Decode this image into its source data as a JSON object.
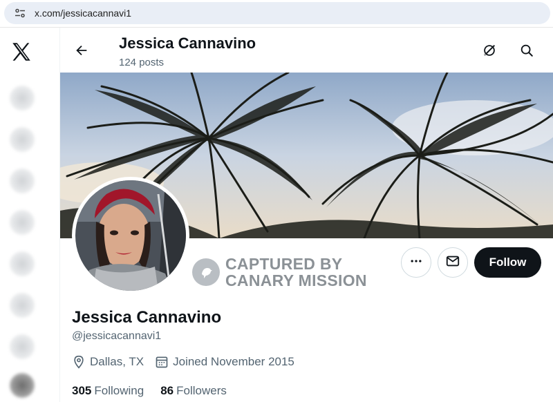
{
  "browser": {
    "url": "x.com/jessicacannavi1",
    "site_info_icon": "tune-icon"
  },
  "sidebar": {
    "logo": "x-logo-icon",
    "blurred_items": 8
  },
  "header": {
    "back_icon": "arrow-left-icon",
    "name": "Jessica Cannavino",
    "posts": "124 posts",
    "grok_icon": "grok-icon",
    "search_icon": "search-icon"
  },
  "banner": {
    "description": "palm trees silhouette against sky"
  },
  "watermark": {
    "line1": "CAPTURED BY",
    "line2": "CANARY MISSION",
    "badge_icon": "canary-bird-icon"
  },
  "actions": {
    "more_icon": "more-icon",
    "message_icon": "mail-icon",
    "follow_label": "Follow"
  },
  "profile": {
    "name": "Jessica Cannavino",
    "handle": "@jessicacannavi1",
    "location": "Dallas, TX",
    "joined": "Joined November 2015",
    "following_count": "305",
    "following_label": "Following",
    "followers_count": "86",
    "followers_label": "Followers"
  },
  "colors": {
    "text_primary": "#0f1419",
    "text_secondary": "#536471",
    "follow_bg": "#0f1419",
    "url_pill": "#e9eef6"
  }
}
